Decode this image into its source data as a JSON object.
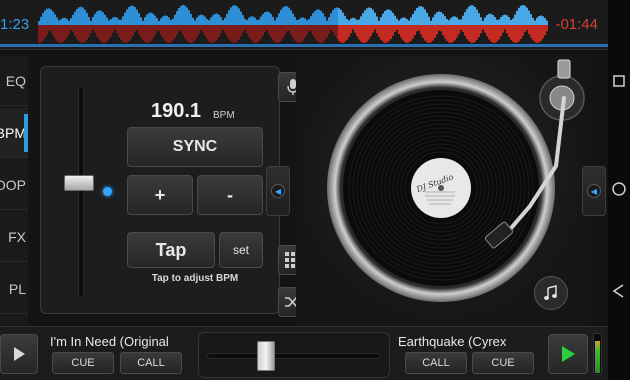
{
  "app": {
    "time_elapsed": "1:23",
    "time_remaining": "-01:44",
    "colors": {
      "accent_blue": "#3a9fe0",
      "accent_red": "#e23b2e",
      "play_green": "#2ecc40"
    }
  },
  "tabs": [
    {
      "label": "EQ",
      "active": false
    },
    {
      "label": "BPM",
      "active": true
    },
    {
      "label": "LOOP",
      "active": false
    },
    {
      "label": "FX",
      "active": false
    },
    {
      "label": "PL",
      "active": false
    }
  ],
  "pitch": {
    "bpm_value": "190.1",
    "bpm_unit": "BPM",
    "sync_label": "SYNC",
    "plus_label": "+",
    "minus_label": "-",
    "tap_label": "Tap",
    "set_label": "set",
    "tap_hint": "Tap to adjust BPM"
  },
  "record_label": "DJ Studio",
  "deck_left": {
    "track_title": "I'm In Need (Original",
    "cue_label": "CUE",
    "call_label": "CALL"
  },
  "deck_right": {
    "track_title": "Earthquake (Cyrex",
    "cue_label": "CUE",
    "call_label": "CALL"
  },
  "icons": {
    "mic": "microphone-icon",
    "grid": "grid-icon",
    "shuffle": "shuffle-icon",
    "music_add": "music-add-icon",
    "nav_back": "back-icon",
    "nav_home": "home-icon",
    "nav_recent": "recent-apps-icon"
  },
  "crossfader_level": 0.32,
  "vu_level": 0.8
}
